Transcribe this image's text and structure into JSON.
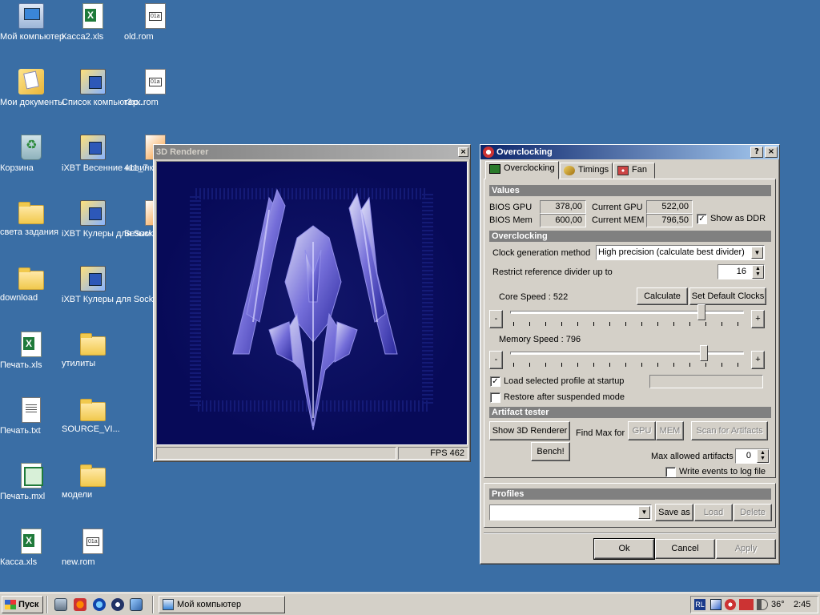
{
  "desktop": {
    "icons": [
      {
        "label": "Мой компьютер",
        "icon": "my-computer-icon"
      },
      {
        "label": "Мои документы",
        "icon": "my-documents-icon"
      },
      {
        "label": "Корзина",
        "icon": "recycle-bin-icon"
      },
      {
        "label": "света задания",
        "icon": "folder-icon"
      },
      {
        "label": "download",
        "icon": "folder-icon"
      },
      {
        "label": "Печать.xls",
        "icon": "excel-file-icon"
      },
      {
        "label": "Печать.txt",
        "icon": "text-file-icon"
      },
      {
        "label": "Печать.mxl",
        "icon": "mxl-file-icon"
      },
      {
        "label": "Касса.xls",
        "icon": "excel-file-icon"
      },
      {
        "label": "Касса2.xls",
        "icon": "excel-file-icon"
      },
      {
        "label": "Список компьютер...",
        "icon": "shortcut-icon"
      },
      {
        "label": "iXBT Весенние новинки Gl...",
        "icon": "shortcut-icon"
      },
      {
        "label": "iXBT Кулеры для Socket ...",
        "icon": "shortcut-icon"
      },
      {
        "label": "iXBT Кулеры для Socket ...",
        "icon": "shortcut-icon"
      },
      {
        "label": "утилиты",
        "icon": "folder-icon"
      },
      {
        "label": "SOURCE_VI...",
        "icon": "folder-icon"
      },
      {
        "label": "модели",
        "icon": "folder-icon"
      },
      {
        "label": "new.rom",
        "icon": "rom-file-icon"
      },
      {
        "label": "old.rom",
        "icon": "rom-file-icon"
      },
      {
        "label": "r3xx.rom",
        "icon": "rom-file-icon"
      },
      {
        "label": "411_7",
        "icon": "image-file-icon"
      },
      {
        "label": "Безым",
        "icon": "image-file-icon"
      }
    ]
  },
  "renderer": {
    "title": "3D Renderer",
    "close": "×",
    "fps": "FPS 462"
  },
  "overclocking": {
    "title": "Overclocking",
    "help": "?",
    "close": "×",
    "tabs": [
      "Overclocking",
      "Timings",
      "Fan"
    ],
    "values_header": "Values",
    "bios_gpu_label": "BIOS GPU",
    "bios_gpu": "378,00",
    "bios_mem_label": "BIOS Mem",
    "bios_mem": "600,00",
    "current_gpu_label": "Current GPU",
    "current_gpu": "522,00",
    "current_mem_label": "Current MEM",
    "current_mem": "796,50",
    "show_ddr": "Show as DDR",
    "show_ddr_checked": true,
    "oc_header": "Overclocking",
    "clock_method_label": "Clock generation method",
    "clock_method_value": "High precision (calculate best divider)",
    "restrict_label": "Restrict reference divider up to",
    "restrict_value": "16",
    "core_speed_label": "Core Speed : 522",
    "calculate": "Calculate",
    "set_default": "Set Default Clocks",
    "minus": "-",
    "plus": "+",
    "memory_speed_label": "Memory Speed : 796",
    "core_slider_level": 0.83,
    "mem_slider_level": 0.84,
    "load_profile": "Load selected profile at startup",
    "load_profile_checked": true,
    "restore_suspended": "Restore after suspended mode",
    "restore_checked": false,
    "artifact_header": "Artifact tester",
    "show_3d": "Show 3D Renderer",
    "find_max": "Find Max for",
    "gpu": "GPU",
    "mem": "MEM",
    "scan": "Scan for Artifacts",
    "bench": "Bench!",
    "max_artifacts_label": "Max allowed artifacts",
    "max_artifacts": "0",
    "write_log": "Write events to log file",
    "profiles_header": "Profiles",
    "save_as": "Save as",
    "load": "Load",
    "delete": "Delete",
    "ok": "Ok",
    "cancel": "Cancel",
    "apply": "Apply"
  },
  "taskbar": {
    "start": "Пуск",
    "task": "Мой компьютер",
    "lang": "RL",
    "temp": "36°",
    "time": "2:45"
  }
}
